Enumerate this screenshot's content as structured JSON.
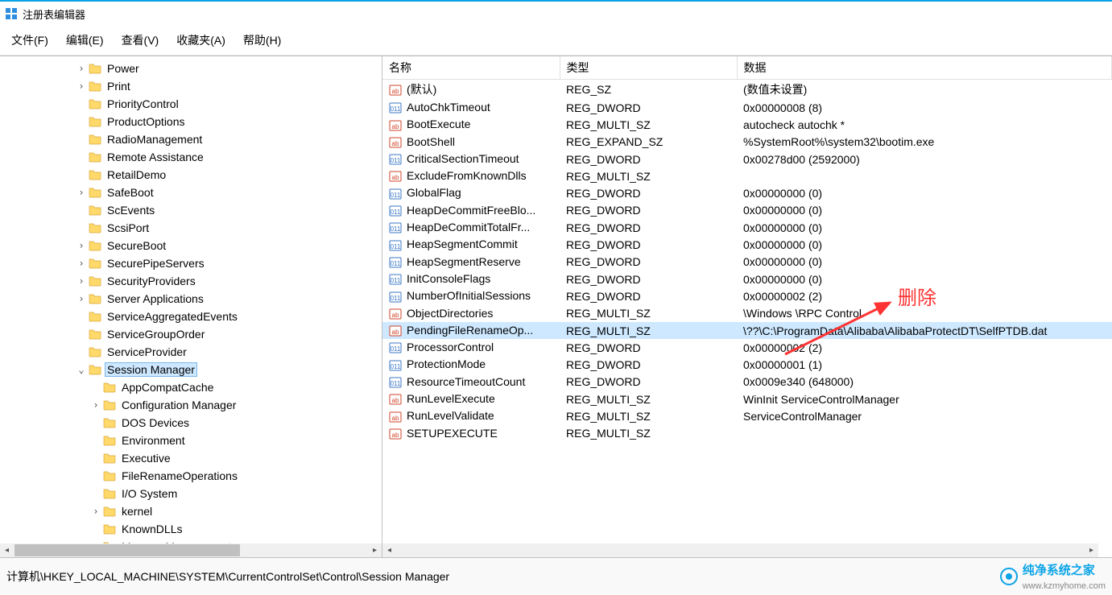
{
  "window": {
    "title": "注册表编辑器"
  },
  "menu": {
    "file": "文件(F)",
    "edit": "编辑(E)",
    "view": "查看(V)",
    "fav": "收藏夹(A)",
    "help": "帮助(H)"
  },
  "tree": {
    "items": [
      {
        "indent": 5,
        "exp": ">",
        "label": "Power"
      },
      {
        "indent": 5,
        "exp": ">",
        "label": "Print"
      },
      {
        "indent": 5,
        "exp": "",
        "label": "PriorityControl"
      },
      {
        "indent": 5,
        "exp": "",
        "label": "ProductOptions"
      },
      {
        "indent": 5,
        "exp": "",
        "label": "RadioManagement"
      },
      {
        "indent": 5,
        "exp": "",
        "label": "Remote Assistance"
      },
      {
        "indent": 5,
        "exp": "",
        "label": "RetailDemo"
      },
      {
        "indent": 5,
        "exp": ">",
        "label": "SafeBoot"
      },
      {
        "indent": 5,
        "exp": "",
        "label": "ScEvents"
      },
      {
        "indent": 5,
        "exp": "",
        "label": "ScsiPort"
      },
      {
        "indent": 5,
        "exp": ">",
        "label": "SecureBoot"
      },
      {
        "indent": 5,
        "exp": ">",
        "label": "SecurePipeServers"
      },
      {
        "indent": 5,
        "exp": ">",
        "label": "SecurityProviders"
      },
      {
        "indent": 5,
        "exp": ">",
        "label": "Server Applications"
      },
      {
        "indent": 5,
        "exp": "",
        "label": "ServiceAggregatedEvents"
      },
      {
        "indent": 5,
        "exp": "",
        "label": "ServiceGroupOrder"
      },
      {
        "indent": 5,
        "exp": "",
        "label": "ServiceProvider"
      },
      {
        "indent": 5,
        "exp": "v",
        "label": "Session Manager",
        "selected": true
      },
      {
        "indent": 6,
        "exp": "",
        "label": "AppCompatCache"
      },
      {
        "indent": 6,
        "exp": ">",
        "label": "Configuration Manager"
      },
      {
        "indent": 6,
        "exp": "",
        "label": "DOS Devices"
      },
      {
        "indent": 6,
        "exp": "",
        "label": "Environment"
      },
      {
        "indent": 6,
        "exp": "",
        "label": "Executive"
      },
      {
        "indent": 6,
        "exp": "",
        "label": "FileRenameOperations"
      },
      {
        "indent": 6,
        "exp": "",
        "label": "I/O System"
      },
      {
        "indent": 6,
        "exp": ">",
        "label": "kernel"
      },
      {
        "indent": 6,
        "exp": "",
        "label": "KnownDLLs"
      },
      {
        "indent": 6,
        "exp": ">",
        "label": "Memory Management"
      }
    ]
  },
  "list": {
    "headers": {
      "name": "名称",
      "type": "类型",
      "data": "数据"
    },
    "rows": [
      {
        "icon": "sz",
        "name": "(默认)",
        "type": "REG_SZ",
        "data": "(数值未设置)"
      },
      {
        "icon": "dw",
        "name": "AutoChkTimeout",
        "type": "REG_DWORD",
        "data": "0x00000008 (8)"
      },
      {
        "icon": "sz",
        "name": "BootExecute",
        "type": "REG_MULTI_SZ",
        "data": "autocheck autochk *"
      },
      {
        "icon": "sz",
        "name": "BootShell",
        "type": "REG_EXPAND_SZ",
        "data": "%SystemRoot%\\system32\\bootim.exe"
      },
      {
        "icon": "dw",
        "name": "CriticalSectionTimeout",
        "type": "REG_DWORD",
        "data": "0x00278d00 (2592000)"
      },
      {
        "icon": "sz",
        "name": "ExcludeFromKnownDlls",
        "type": "REG_MULTI_SZ",
        "data": ""
      },
      {
        "icon": "dw",
        "name": "GlobalFlag",
        "type": "REG_DWORD",
        "data": "0x00000000 (0)"
      },
      {
        "icon": "dw",
        "name": "HeapDeCommitFreeBlo...",
        "type": "REG_DWORD",
        "data": "0x00000000 (0)"
      },
      {
        "icon": "dw",
        "name": "HeapDeCommitTotalFr...",
        "type": "REG_DWORD",
        "data": "0x00000000 (0)"
      },
      {
        "icon": "dw",
        "name": "HeapSegmentCommit",
        "type": "REG_DWORD",
        "data": "0x00000000 (0)"
      },
      {
        "icon": "dw",
        "name": "HeapSegmentReserve",
        "type": "REG_DWORD",
        "data": "0x00000000 (0)"
      },
      {
        "icon": "dw",
        "name": "InitConsoleFlags",
        "type": "REG_DWORD",
        "data": "0x00000000 (0)"
      },
      {
        "icon": "dw",
        "name": "NumberOfInitialSessions",
        "type": "REG_DWORD",
        "data": "0x00000002 (2)"
      },
      {
        "icon": "sz",
        "name": "ObjectDirectories",
        "type": "REG_MULTI_SZ",
        "data": "\\Windows \\RPC Control"
      },
      {
        "icon": "sz",
        "name": "PendingFileRenameOp...",
        "type": "REG_MULTI_SZ",
        "data": "\\??\\C:\\ProgramData\\Alibaba\\AlibabaProtectDT\\SelfPTDB.dat",
        "selected": true
      },
      {
        "icon": "dw",
        "name": "ProcessorControl",
        "type": "REG_DWORD",
        "data": "0x00000002 (2)"
      },
      {
        "icon": "dw",
        "name": "ProtectionMode",
        "type": "REG_DWORD",
        "data": "0x00000001 (1)"
      },
      {
        "icon": "dw",
        "name": "ResourceTimeoutCount",
        "type": "REG_DWORD",
        "data": "0x0009e340 (648000)"
      },
      {
        "icon": "sz",
        "name": "RunLevelExecute",
        "type": "REG_MULTI_SZ",
        "data": "WinInit ServiceControlManager"
      },
      {
        "icon": "sz",
        "name": "RunLevelValidate",
        "type": "REG_MULTI_SZ",
        "data": "ServiceControlManager"
      },
      {
        "icon": "sz",
        "name": "SETUPEXECUTE",
        "type": "REG_MULTI_SZ",
        "data": ""
      }
    ]
  },
  "statusbar": {
    "path": "计算机\\HKEY_LOCAL_MACHINE\\SYSTEM\\CurrentControlSet\\Control\\Session Manager"
  },
  "annotation": {
    "text": "删除"
  },
  "watermark": {
    "brand": "纯净系统之家",
    "url": "www.kzmyhome.com"
  }
}
